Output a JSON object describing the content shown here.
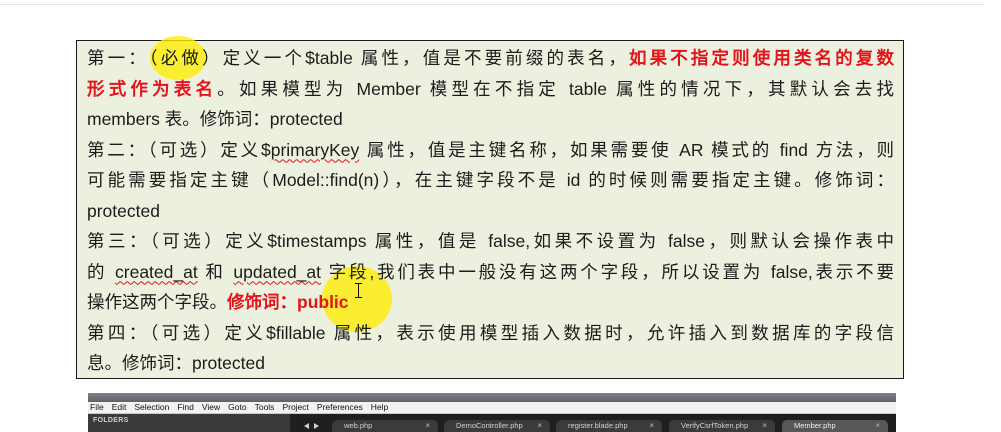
{
  "note": {
    "lines": [
      [
        "第一：（",
        "必做",
        "）定义一个$table 属性，值是不要前缀的表名，",
        "如果不指定则使用类名的复数"
      ],
      [
        "形式作为表名",
        "。如果模型为 Member 模型在不指定 table 属性的情况下，其默认会去找"
      ],
      [
        "members 表。修饰词：protected"
      ],
      [
        "第二：（可选）定义$",
        "primaryKey",
        " 属性，值是主键名称，如果需要使 AR 模式的 find 方法，则"
      ],
      [
        "可能需要指定主键（Model::find(n)），在主键字段不是 id 的时候则需要指定主键。修饰词："
      ],
      [
        "protected"
      ],
      [
        "第三：（可选）定义$timestamps 属性，值是 false,如果不设置为 false，则默认会操作表中"
      ],
      [
        "的 ",
        "created_at",
        " 和 ",
        "updated_at",
        " 字段,我们表中一般没有这两个字段，所以设置为 false,表示不要"
      ],
      [
        "操作这两个字段。",
        "修饰词：public"
      ],
      [
        "第四：（可选）定义$fillable 属性，表示使用模型插入数据时，允许插入到数据库的字段信"
      ],
      [
        "息。修饰词：protected"
      ]
    ]
  },
  "editor": {
    "menu": [
      "File",
      "Edit",
      "Selection",
      "Find",
      "View",
      "Goto",
      "Tools",
      "Project",
      "Preferences",
      "Help"
    ],
    "sidebar_header": "FOLDERS",
    "close_glyph": "×",
    "tabs": [
      {
        "label": "web.php"
      },
      {
        "label": "DemoController.php"
      },
      {
        "label": "register.blade.php"
      },
      {
        "label": "VerifyCsrfToken.php"
      },
      {
        "label": "Member.php",
        "active": true
      }
    ],
    "icons": {
      "tab_scroll_left": "tab-scroll-left-icon",
      "tab_scroll_right": "tab-scroll-right-icon"
    }
  },
  "colors": {
    "note_background": "#ebf1de",
    "emphasis_red": "#e2141b",
    "cursor_highlight": "#ffec00",
    "editor_dark": "#1f1f1f"
  }
}
